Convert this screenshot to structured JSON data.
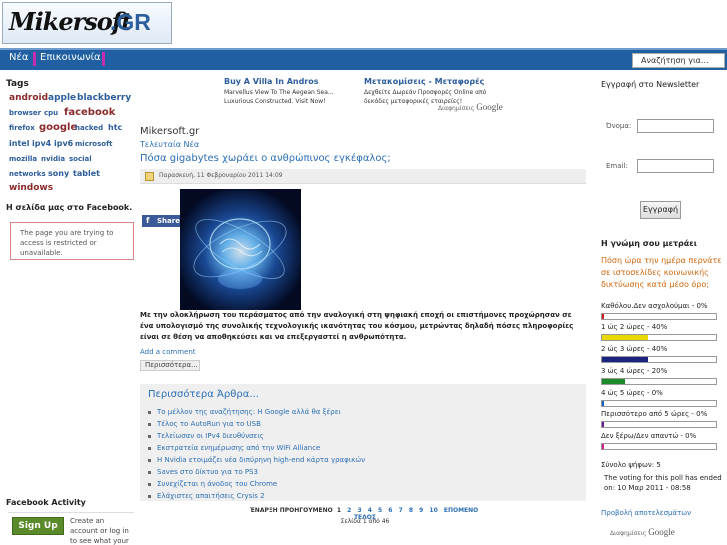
{
  "logo": {
    "text1": "Mikersoft",
    "text2": ".GR"
  },
  "nav": {
    "items": [
      "Νέα",
      "Επικοινωνία"
    ],
    "search_placeholder": "Αναζήτηση για..."
  },
  "left": {
    "tags_title": "Tags",
    "tags": [
      "android",
      "apple",
      "blackberry",
      "browser",
      "cpu",
      "facebook",
      "firefox",
      "google",
      "hacked",
      "htc",
      "intel",
      "ipv4",
      "ipv6",
      "microsoft",
      "mozilla",
      "nvidia",
      "social",
      "networks",
      "sony",
      "tablet",
      "windows"
    ],
    "facebook_title": "Η σελίδα μας στο Facebook.",
    "facebook_msg": "The page you are trying to access is restricted or unavailable.",
    "activity_title": "Facebook Activity",
    "signup_label": "Sign Up",
    "signup_text": "Create an account or log in to see what your friends are doing."
  },
  "ads": [
    {
      "title": "Buy A Villa In Andros",
      "desc": "Marvellus View To The Aegean Sea... Luxurious Constructed. Visit Now!"
    },
    {
      "title": "Μετακομίσεις - Μεταφορές",
      "desc": "Δεχθείτε Δωρεάν Προσφορές Online από δεκάδες μεταφορικές εταιρείες!"
    }
  ],
  "google_ads_label": "Διαφημίσεις",
  "google_word": "Google",
  "main": {
    "blog_title": "Mikersoft.gr",
    "latest_label": "Τελευταία Νέα",
    "post_title": "Πόσα gigabytes χωράει ο ανθρώπινος εγκέφαλος;",
    "post_date": "Παρασκευή, 11 Φεβρουαρίου 2011 14:09",
    "share_label": "Share",
    "post_body": "Με την ολοκλήρωση του περάσματος από την αναλογική στη ψηφιακή εποχή οι επιστήμονες προχώρησαν σε ένα υπολογισμό της συνολικής τεχνολογικής ικανότητας του κόσμου, μετρώντας δηλαδή πόσες πληροφορίες είναι σε θέση να αποθηκεύσει και να επεξεργαστεί η ανθρωπότητα.",
    "add_comment": "Add a comment",
    "more_button": "Περισσότερα...",
    "more_articles_title": "Περισσότερα Άρθρα...",
    "more_articles": [
      "Το μέλλον της αναζήτησης: Η Google αλλά θα ξέρει",
      "Τέλος το AutoRun για το USB",
      "Τελείωσαν οι IPv4 διευθύνσεις",
      "Εκστρατεία ενημέρωσης από την WiFi Alliance",
      "Η Nvidia ετοιμάζει νέα διπύρηνη high-end κάρτα γραφικών",
      "Saves στο δίκτυο για το PS3",
      "Συνεχίζεται η άνοδος του Chrome",
      "Ελάχιστες απαιτήσεις Crysis 2"
    ],
    "pager_start": "ΈΝΑΡΞΗ",
    "pager_prev": "ΠΡΟΗΓΟΥΜΕΝΟ",
    "pager_pages": [
      "1",
      "2",
      "3",
      "4",
      "5",
      "6",
      "7",
      "8",
      "9",
      "10"
    ],
    "pager_next": "ΕΠΟΜΕΝΟ",
    "pager_end": "ΤΕΛΟΣ",
    "pager_sub": "Σελίδα 1 από 46"
  },
  "right": {
    "newsletter_title": "Εγγραφή στο Newsletter",
    "name_label": "Όνομα:",
    "email_label": "Email:",
    "subscribe_label": "Εγγραφή",
    "poll_title": "Η γνώμη σου μετράει",
    "poll_question": "Πόση ώρα την ημέρα περνάτε σε ιστοσελίδες κοινωνικής δικτύωσης κατά μέσο όρο;",
    "poll_options": [
      {
        "label": "Καθόλου.Δεν ασχολούμαι - 0%",
        "percent": 0,
        "color": "#cc2222"
      },
      {
        "label": "1 ώς 2 ώρες - 40%",
        "percent": 40,
        "color": "#e8d800"
      },
      {
        "label": "2 ώς 3 ώρες - 40%",
        "percent": 40,
        "color": "#1a237e"
      },
      {
        "label": "3 ώς 4 ώρες - 20%",
        "percent": 20,
        "color": "#1e8a2a"
      },
      {
        "label": "4 ώς 5 ώρες - 0%",
        "percent": 0,
        "color": "#1565c0"
      },
      {
        "label": "Περισσότερο από 5 ώρες - 0%",
        "percent": 0,
        "color": "#6a1b9a"
      },
      {
        "label": "Δεν ξέρω/Δεν απαντώ - 0%",
        "percent": 0,
        "color": "#d81b8a"
      }
    ],
    "total_votes": "Σύνολο ψήφων: 5",
    "poll_ended": "The voting for this poll has ended on: 10 Μαρ 2011 - 08:58",
    "poll_results": "Προβολή αποτελεσμάτων"
  }
}
